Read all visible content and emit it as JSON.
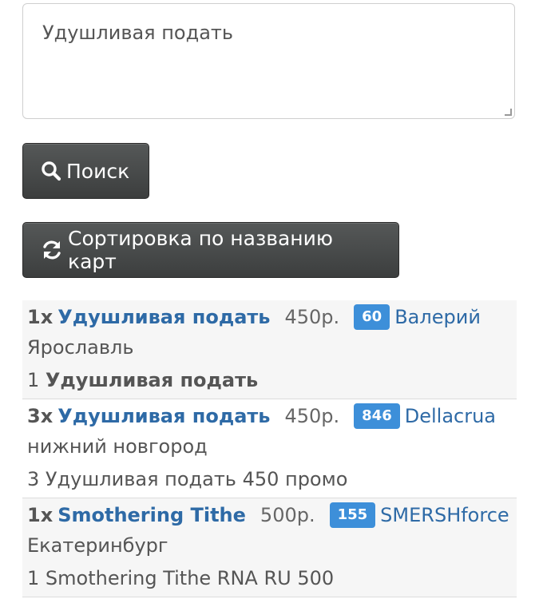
{
  "search": {
    "value": "Удушливая подать"
  },
  "buttons": {
    "search_label": "Поиск",
    "sort_label": "Сортировка по названию карт"
  },
  "results": [
    {
      "qty": "1x",
      "card": "Удушливая подать",
      "price": "450р.",
      "rating": "60",
      "seller": "Валерий",
      "city": "Ярославль",
      "desc_prefix": "1 ",
      "desc_bold": "Удушливая подать",
      "desc_suffix": ""
    },
    {
      "qty": "3x",
      "card": "Удушливая подать",
      "price": "450р.",
      "rating": "846",
      "seller": "Dellacrua",
      "city": "нижний новгород",
      "desc_prefix": "3 Удушливая подать 450 промо",
      "desc_bold": "",
      "desc_suffix": ""
    },
    {
      "qty": "1x",
      "card": "Smothering Tithe",
      "price": "500р.",
      "rating": "155",
      "seller": "SMERSHforce",
      "city": "Екатеринбург",
      "desc_prefix": "1 Smothering Tithe RNA RU 500",
      "desc_bold": "",
      "desc_suffix": ""
    }
  ],
  "colors": {
    "link": "#2e6aa6",
    "badge": "#3d8fd9",
    "button": "#474949"
  },
  "icons": {
    "search": "search-icon",
    "sort": "refresh-icon"
  }
}
